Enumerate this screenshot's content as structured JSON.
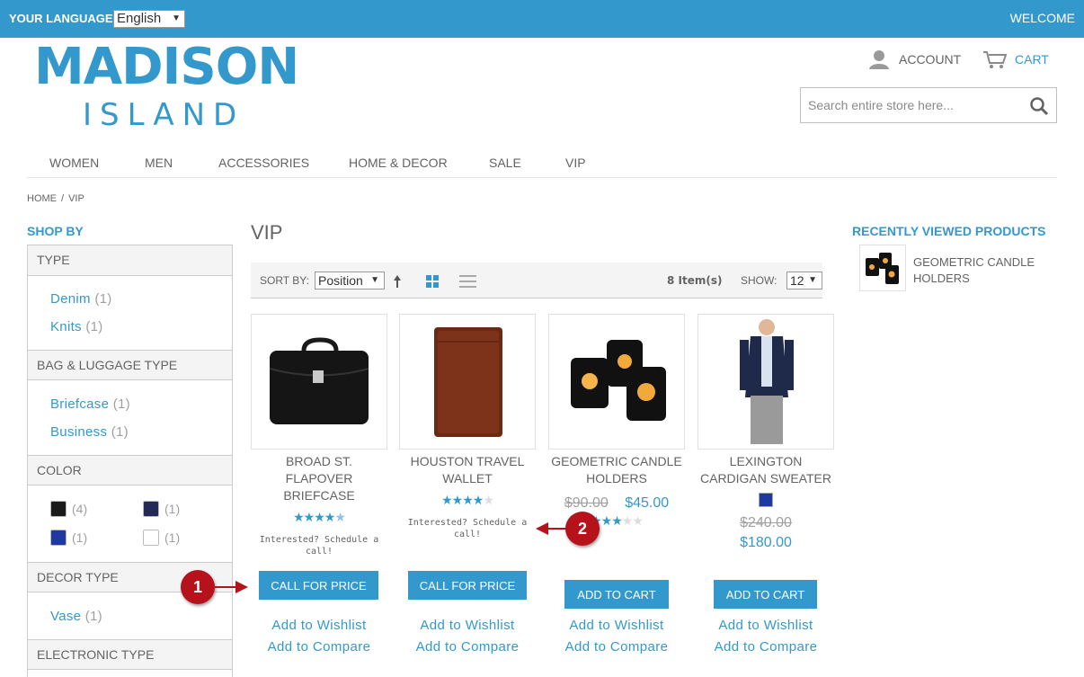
{
  "topbar": {
    "language_label": "YOUR LANGUAGE:",
    "language_value": "English",
    "welcome": "WELCOME"
  },
  "logo": {
    "main": "MADISON",
    "sub": "ISLAND"
  },
  "header": {
    "account": "ACCOUNT",
    "cart": "CART",
    "search_placeholder": "Search entire store here..."
  },
  "nav": [
    "WOMEN",
    "MEN",
    "ACCESSORIES",
    "HOME & DECOR",
    "SALE",
    "VIP"
  ],
  "breadcrumb": {
    "home": "HOME",
    "sep": "/",
    "current": "VIP"
  },
  "sidebar": {
    "title": "SHOP BY",
    "type": {
      "title": "TYPE",
      "items": [
        {
          "label": "Denim",
          "count": "(1)"
        },
        {
          "label": "Knits",
          "count": "(1)"
        }
      ]
    },
    "bag": {
      "title": "BAG & LUGGAGE TYPE",
      "items": [
        {
          "label": "Briefcase",
          "count": "(1)"
        },
        {
          "label": "Business",
          "count": "(1)"
        }
      ]
    },
    "color": {
      "title": "COLOR",
      "items": [
        {
          "color": "#1a1a1a",
          "count": "(4)"
        },
        {
          "color": "#222a55",
          "count": "(1)"
        },
        {
          "color": "#1e3aa0",
          "count": "(1)"
        },
        {
          "color": "#ffffff",
          "count": "(1)"
        }
      ]
    },
    "decor": {
      "title": "DECOR TYPE",
      "items": [
        {
          "label": "Vase",
          "count": "(1)"
        }
      ]
    },
    "electronic": {
      "title": "ELECTRONIC TYPE"
    }
  },
  "main": {
    "title": "VIP",
    "toolbar": {
      "sort_label": "SORT BY:",
      "sort_value": "Position",
      "items": "8 Item(s)",
      "show_label": "SHOW:",
      "show_value": "12"
    },
    "products": [
      {
        "name_l1": "BROAD ST. FLAPOVER",
        "name_l2": "BRIEFCASE",
        "rating": 4.5,
        "note": "Interested? Schedule a call!",
        "button": "CALL FOR PRICE",
        "wishlist": "Add to Wishlist",
        "compare": "Add to Compare"
      },
      {
        "name_l1": "HOUSTON TRAVEL",
        "name_l2": "WALLET",
        "rating": 4,
        "note": "Interested? Schedule a call!",
        "button": "CALL FOR PRICE",
        "wishlist": "Add to Wishlist",
        "compare": "Add to Compare"
      },
      {
        "name_l1": "GEOMETRIC CANDLE",
        "name_l2": "HOLDERS",
        "old_price": "$90.00",
        "price": "$45.00",
        "rating": 3,
        "button": "ADD TO CART",
        "wishlist": "Add to Wishlist",
        "compare": "Add to Compare"
      },
      {
        "name_l1": "LEXINGTON",
        "name_l2": "CARDIGAN SWEATER",
        "swatch": "#1e3aa0",
        "old_price": "$240.00",
        "price": "$180.00",
        "button": "ADD TO CART",
        "wishlist": "Add to Wishlist",
        "compare": "Add to Compare"
      }
    ]
  },
  "recently_viewed": {
    "title": "RECENTLY VIEWED PRODUCTS",
    "item": "GEOMETRIC CANDLE HOLDERS"
  },
  "callouts": [
    "1",
    "2"
  ],
  "colors": {
    "accent": "#3399cc",
    "callout": "#b5121b"
  }
}
